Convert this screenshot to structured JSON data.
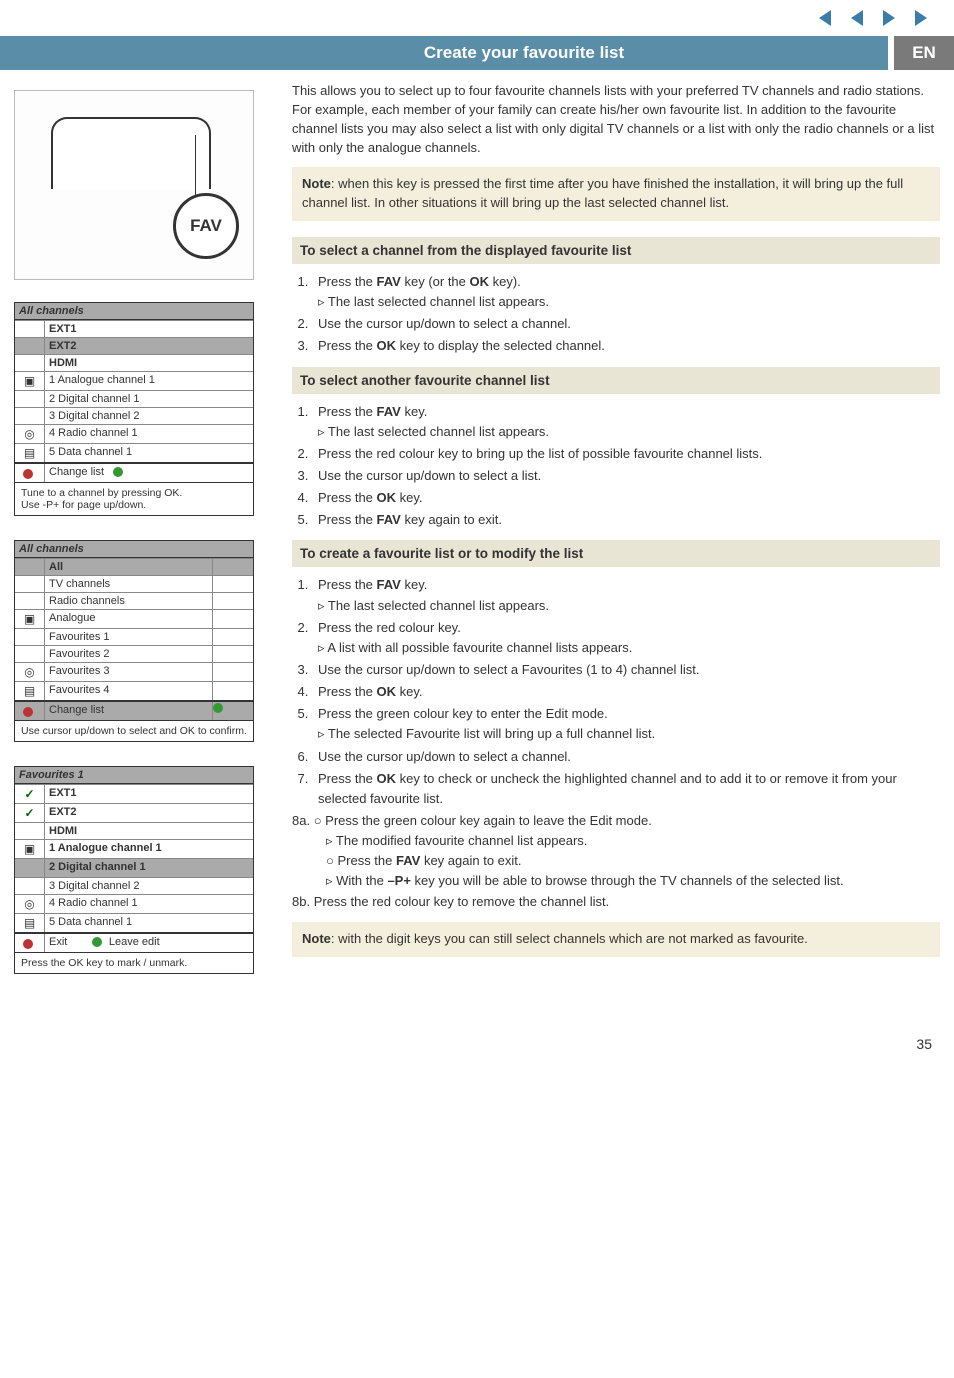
{
  "page_number": "35",
  "title_bar": {
    "main": "Create your favourite list",
    "lang": "EN"
  },
  "fav_label": "FAV",
  "remote_buttons": [
    "•",
    "⊞",
    "⊡",
    "FAV"
  ],
  "osd1": {
    "title": "All channels",
    "rows_top": [
      "EXT1",
      "EXT2",
      "HDMI"
    ],
    "rows_mid": [
      {
        "icon": "▣",
        "text": "1 Analogue channel 1"
      },
      {
        "icon": "",
        "text": "2 Digital channel 1"
      },
      {
        "icon": "",
        "text": "3 Digital channel 2"
      },
      {
        "icon": "◎",
        "text": "4 Radio channel 1"
      },
      {
        "icon": "▤",
        "text": "5 Data channel 1"
      }
    ],
    "change": "Change list",
    "foot": "Tune to a channel by pressing OK.\nUse -P+ for page up/down."
  },
  "osd2": {
    "title": "All channels",
    "rows": [
      "All",
      "TV channels",
      "Radio channels",
      "Analogue",
      "Favourites 1",
      "Favourites 2",
      "Favourites 3",
      "Favourites 4"
    ],
    "icons": [
      "",
      "",
      "",
      "▣",
      "",
      "",
      "◎",
      "▤"
    ],
    "change": "Change list",
    "foot": "Use cursor up/down to select and OK to confirm."
  },
  "osd3": {
    "title": "Favourites 1",
    "rows_top": [
      "EXT1",
      "EXT2",
      "HDMI"
    ],
    "rows_mid": [
      {
        "icon": "▣",
        "check": true,
        "text": "1 Analogue channel 1"
      },
      {
        "icon": "",
        "check": false,
        "text": "2 Digital channel 1"
      },
      {
        "icon": "",
        "check": null,
        "text": "3 Digital channel 2"
      },
      {
        "icon": "◎",
        "check": null,
        "text": "4 Radio channel 1"
      },
      {
        "icon": "▤",
        "check": null,
        "text": "5 Data channel 1"
      }
    ],
    "exit": "Exit",
    "leave": "Leave edit",
    "foot": "Press the OK key to mark / unmark."
  },
  "intro": "This allows you to select up to four favourite channels lists with your preferred TV channels and radio stations. For example, each member of your family can create his/her own favourite list. In addition to the favourite channel lists you may also select a list with only digital TV channels or a list with only the radio channels or a list with only the analogue channels.",
  "note1_pre": "Note",
  "note1": ": when this key is pressed the first time after you have finished the installation, it will bring up the full channel list. In other situations it will bring up the last selected channel list.",
  "sec1": {
    "h": "To select a channel from the displayed favourite list",
    "s1a": "Press the ",
    "s1b": "FAV",
    "s1c": " key (or the ",
    "s1d": "OK",
    "s1e": " key).",
    "s1sub": "The last selected channel list appears.",
    "s2": "Use the cursor up/down to select a channel.",
    "s3a": "Press the ",
    "s3b": "OK",
    "s3c": " key to display the selected channel."
  },
  "sec2": {
    "h": "To select another favourite channel list",
    "s1a": "Press the ",
    "s1b": "FAV",
    "s1c": " key.",
    "s1sub": "The last selected channel list appears.",
    "s2": "Press the red colour key to bring up the list of possible favourite channel lists.",
    "s3": "Use the cursor up/down to select a list.",
    "s4a": "Press the ",
    "s4b": "OK",
    "s4c": " key.",
    "s5a": "Press the ",
    "s5b": "FAV",
    "s5c": " key again to exit."
  },
  "sec3": {
    "h": "To create a favourite list or to modify the list",
    "s1a": "Press the ",
    "s1b": "FAV",
    "s1c": " key.",
    "s1sub": "The last selected channel list appears.",
    "s2": "Press the red colour key.",
    "s2sub": "A list with all possible favourite channel lists appears.",
    "s3": "Use the cursor up/down to select a Favourites (1 to 4) channel list.",
    "s4a": "Press the ",
    "s4b": "OK",
    "s4c": " key.",
    "s5": "Press the green colour key to enter the Edit mode.",
    "s5sub": "The selected Favourite list will bring up a full channel list.",
    "s6": "Use the cursor up/down to select a channel.",
    "s7a": "Press the ",
    "s7b": "OK",
    "s7c": " key to check or uncheck the highlighted channel and to add it to or remove it from your selected favourite list.",
    "s8a_label": "8a.",
    "s8a": "Press the green colour key again to leave the Edit mode.",
    "s8a_sub1": "The modified favourite channel list appears.",
    "s8a_sub2a": "Press the ",
    "s8a_sub2b": "FAV",
    "s8a_sub2c": " key again to exit.",
    "s8a_sub3a": "With the ",
    "s8a_sub3b": "–P+",
    "s8a_sub3c": " key you will be able to browse through the TV channels of the selected list.",
    "s8b_label": "8b.",
    "s8b": "Press the red colour key to remove the channel list."
  },
  "note2_pre": "Note",
  "note2": ": with the digit keys you can still select channels which are not marked as favourite."
}
